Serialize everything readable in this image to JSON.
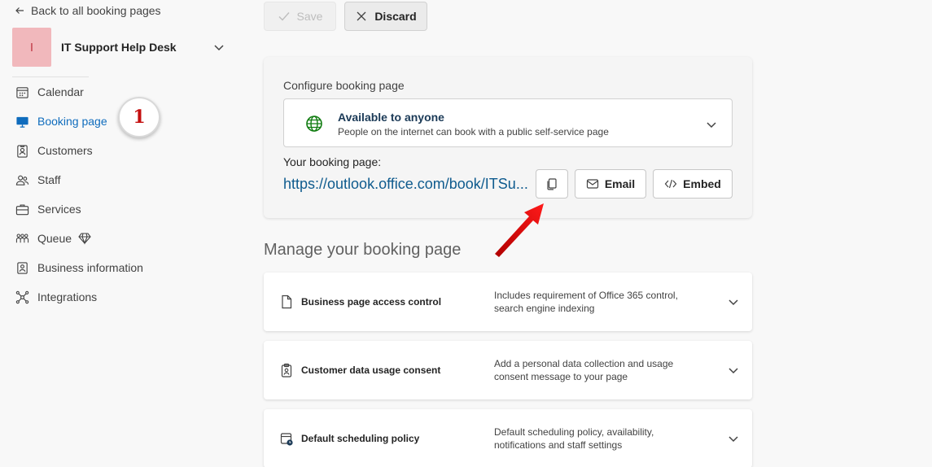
{
  "sidebar": {
    "back_label": "Back to all booking pages",
    "business": {
      "initial": "I",
      "name": "IT Support Help Desk"
    },
    "items": [
      {
        "label": "Calendar",
        "icon": "calendar-icon",
        "active": false
      },
      {
        "label": "Booking page",
        "icon": "monitor-icon",
        "active": true
      },
      {
        "label": "Customers",
        "icon": "contact-card-icon",
        "active": false
      },
      {
        "label": "Staff",
        "icon": "people-icon",
        "active": false
      },
      {
        "label": "Services",
        "icon": "briefcase-icon",
        "active": false
      },
      {
        "label": "Queue",
        "icon": "people-queue-icon",
        "active": false,
        "badge_icon": "diamond-premium-icon"
      },
      {
        "label": "Business information",
        "icon": "building-icon",
        "active": false
      },
      {
        "label": "Integrations",
        "icon": "network-icon",
        "active": false
      }
    ],
    "step_badge": "1"
  },
  "toolbar": {
    "save_label": "Save",
    "discard_label": "Discard"
  },
  "config": {
    "title": "Configure booking page",
    "availability": {
      "title": "Available to anyone",
      "subtitle": "People on the internet can book with a public self-service page"
    },
    "your_page_label": "Your booking page:",
    "url": "https://outlook.office.com/book/ITSu...",
    "email_label": "Email",
    "embed_label": "Embed"
  },
  "manage": {
    "title": "Manage your booking page",
    "cards": [
      {
        "title": "Business page access control",
        "desc": "Includes requirement of Office 365 control, search engine indexing",
        "icon": "document-icon"
      },
      {
        "title": "Customer data usage consent",
        "desc": "Add a personal data collection and usage consent message to your page",
        "icon": "clipboard-icon"
      },
      {
        "title": "Default scheduling policy",
        "desc": "Default scheduling policy, availability, notifications and staff settings",
        "icon": "calendar-clock-icon"
      }
    ]
  },
  "colors": {
    "accent": "#0f6cbd",
    "avatar_bg": "#f1b8bc",
    "annotation_red": "#e00000"
  }
}
